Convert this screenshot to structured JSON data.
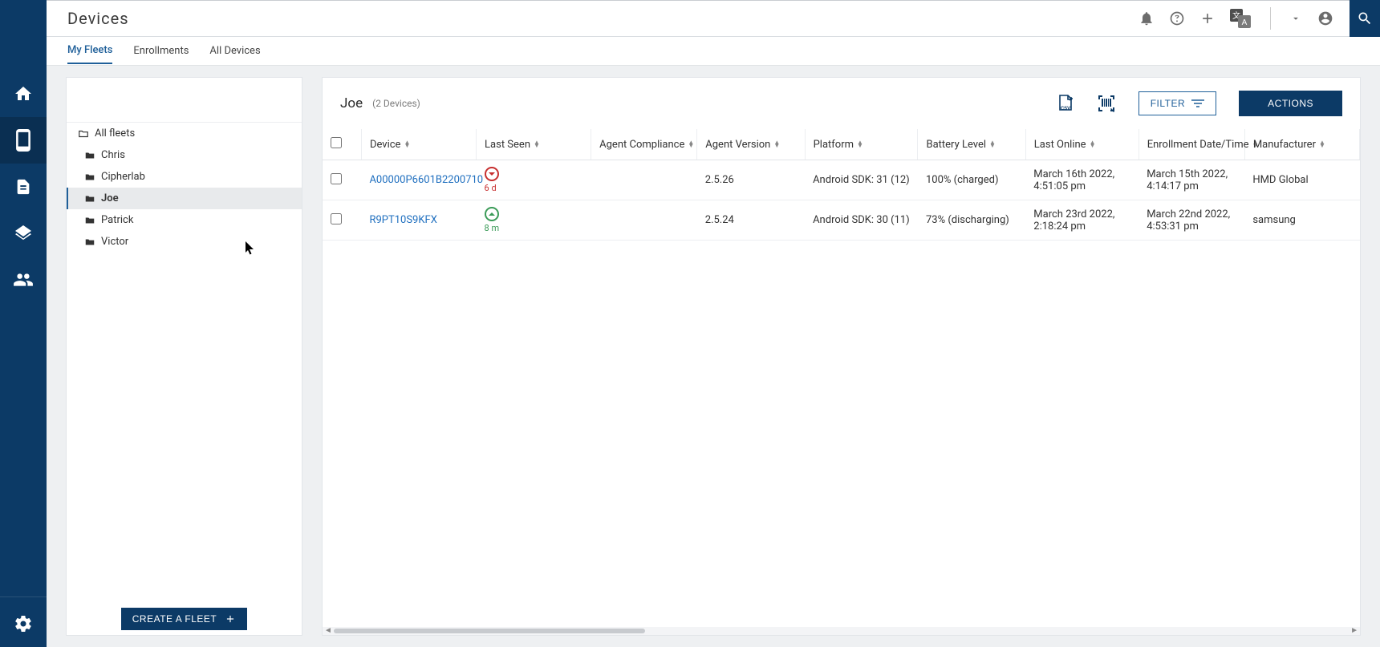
{
  "page_title": "Devices",
  "tabs": {
    "my_fleets": "My Fleets",
    "enrollments": "Enrollments",
    "all_devices": "All Devices"
  },
  "sidebar": {
    "all_fleets": "All fleets",
    "items": [
      {
        "label": "Chris"
      },
      {
        "label": "Cipherlab"
      },
      {
        "label": "Joe"
      },
      {
        "label": "Patrick"
      },
      {
        "label": "Victor"
      }
    ],
    "create_fleet": "CREATE A FLEET"
  },
  "main": {
    "fleet_name": "Joe",
    "fleet_count": "(2 Devices)",
    "filter_label": "FILTER",
    "actions_label": "ACTIONS",
    "columns": {
      "device": "Device",
      "last_seen": "Last Seen",
      "agent_compliance": "Agent Compliance",
      "agent_version": "Agent Version",
      "platform": "Platform",
      "battery_level": "Battery Level",
      "last_online": "Last Online",
      "enrollment": "Enrollment Date/Time",
      "manufacturer": "Manufacturer"
    },
    "rows": [
      {
        "device": "A00000P6601B2200710",
        "last_seen_status": "down",
        "last_seen_text": "6 d",
        "agent_compliance": "",
        "agent_version": "2.5.26",
        "platform": "Android SDK: 31 (12)",
        "battery": "100% (charged)",
        "last_online": "March 16th 2022, 4:51:05 pm",
        "enrollment": "March 15th 2022, 4:14:17 pm",
        "manufacturer": "HMD Global"
      },
      {
        "device": "R9PT10S9KFX",
        "last_seen_status": "up",
        "last_seen_text": "8 m",
        "agent_compliance": "",
        "agent_version": "2.5.24",
        "platform": "Android SDK: 30 (11)",
        "battery": "73% (discharging)",
        "last_online": "March 23rd 2022, 2:18:24 pm",
        "enrollment": "March 22nd 2022, 4:53:31 pm",
        "manufacturer": "samsung"
      }
    ]
  }
}
